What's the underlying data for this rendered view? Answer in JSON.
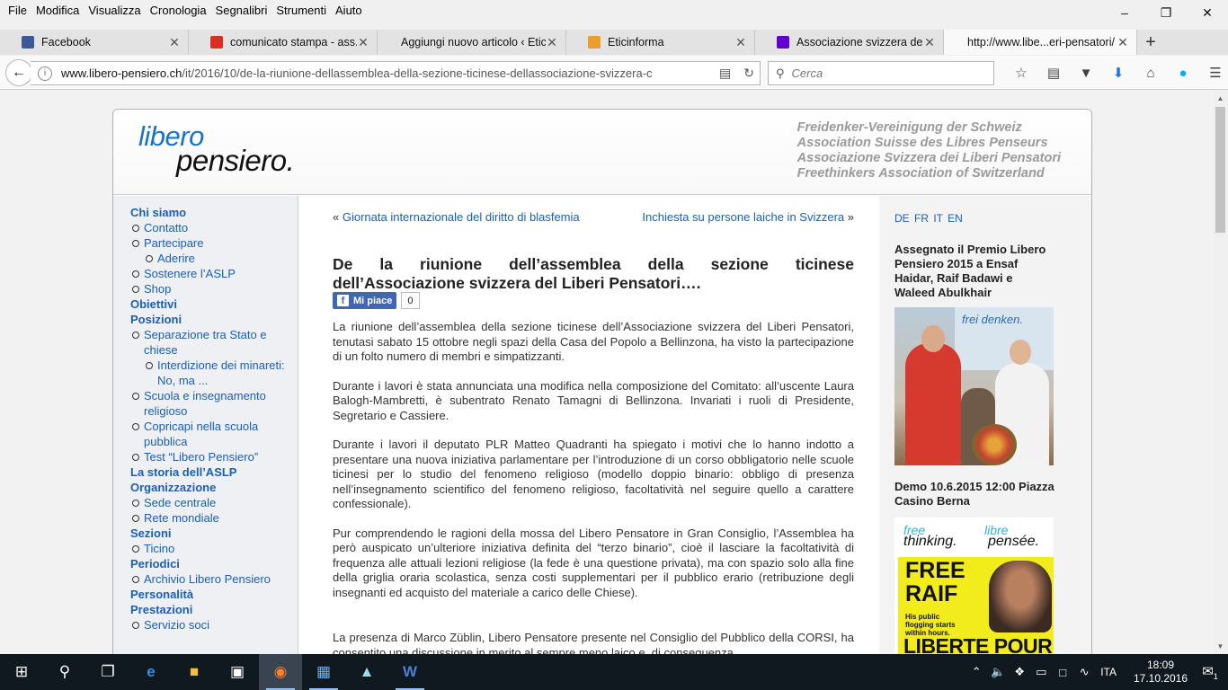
{
  "menubar": [
    "File",
    "Modifica",
    "Visualizza",
    "Cronologia",
    "Segnalibri",
    "Strumenti",
    "Aiuto"
  ],
  "tabs": [
    {
      "label": "Facebook",
      "color": "#3b5998"
    },
    {
      "label": "comunicato stampa - ass...",
      "color": "#d93025"
    },
    {
      "label": "Aggiungi nuovo articolo ‹ Etici...",
      "color": ""
    },
    {
      "label": "Eticinforma",
      "color": "#e8a02a"
    },
    {
      "label": "Associazione svizzera del L...",
      "color": "#5f01d1"
    },
    {
      "label": "http://www.libe...eri-pensatori/",
      "color": ""
    }
  ],
  "url": {
    "domain": "www.libero-pensiero.ch",
    "path": "/it/2016/10/de-la-riunione-dellassemblea-della-sezione-ticinese-dellassociazione-svizzera-c"
  },
  "search": {
    "placeholder": "Cerca"
  },
  "site": {
    "logo_top": "libero",
    "logo_bottom": "pensiero.",
    "taglines": [
      "Freidenker-Vereinigung der Schweiz",
      "Association Suisse des Libres Penseurs",
      "Associazione Svizzera dei Liberi Pensatori",
      "Freethinkers Association of Switzerland"
    ]
  },
  "leftnav": [
    {
      "type": "sec",
      "label": "Chi siamo"
    },
    {
      "type": "it",
      "label": "Contatto"
    },
    {
      "type": "it",
      "label": "Partecipare"
    },
    {
      "type": "it2",
      "label": "Aderire"
    },
    {
      "type": "it",
      "label": "Sostenere l’ASLP"
    },
    {
      "type": "it",
      "label": "Shop"
    },
    {
      "type": "sec",
      "label": "Obiettivi"
    },
    {
      "type": "sec",
      "label": "Posizioni"
    },
    {
      "type": "it",
      "label": "Separazione tra Stato e chiese"
    },
    {
      "type": "it2",
      "label": "Interdizione dei minareti: No, ma ..."
    },
    {
      "type": "it",
      "label": "Scuola e insegnamento religioso"
    },
    {
      "type": "it",
      "label": "Copricapi nella scuola pubblica"
    },
    {
      "type": "it",
      "label": "Test “Libero Pensiero”"
    },
    {
      "type": "sec",
      "label": "La storia dell’ASLP"
    },
    {
      "type": "sec",
      "label": "Organizzazione"
    },
    {
      "type": "it",
      "label": "Sede centrale"
    },
    {
      "type": "it",
      "label": "Rete mondiale"
    },
    {
      "type": "sec",
      "label": "Sezioni"
    },
    {
      "type": "it",
      "label": "Ticino"
    },
    {
      "type": "sec",
      "label": "Periodici"
    },
    {
      "type": "it",
      "label": "Archivio Libero Pensiero"
    },
    {
      "type": "sec",
      "label": "Personalità"
    },
    {
      "type": "sec",
      "label": "Prestazioni"
    },
    {
      "type": "it",
      "label": "Servizio soci"
    }
  ],
  "post_nav": {
    "prev": "Giornata internazionale del diritto di blasfemia",
    "next": "Inchiesta su persone laiche in Svizzera",
    "prev_arrow": "«",
    "next_arrow": "»"
  },
  "article": {
    "title": "De la riunione dell’assemblea della sezione ticinese dell’Associazione svizzera del Liberi Pensatori….",
    "like_label": "Mi piace",
    "like_count": "0",
    "paragraphs": [
      "La riunione dell’assemblea della sezione ticinese dell’Associazione svizzera del Liberi Pensatori, tenutasi sabato 15 ottobre negli spazi della Casa del Popolo a Bellinzona, ha visto la partecipazione di un folto numero di membri e simpatizzanti.",
      "Durante i lavori è stata annunciata una modifica nella composizione del Comitato: all’uscente Laura Balogh-Mambretti, è subentrato Renato Tamagni di Bellinzona. Invariati i ruoli di Presidente, Segretario e Cassiere.",
      "Durante i lavori il deputato PLR Matteo Quadranti ha spiegato i motivi che lo hanno indotto a presentare una nuova iniziativa parlamentare per l’introduzione di un corso obbligatorio nelle scuole ticinesi per lo studio del fenomeno religioso (modello doppio binario: obbligo di presenza nell’insegnamento scientifico del fenomeno religioso, facoltatività nel seguire quello a carattere confessionale).",
      "Pur comprendendo le ragioni della mossa del Libero Pensatore in Gran Consiglio, l’Assemblea ha però auspicato un’ulteriore iniziativa definita del “terzo binario”, cioè il lasciare la facoltatività di frequenza alle attuali lezioni religiose (la fede è una questione privata), ma con spazio solo alla fine della griglia oraria scolastica, senza costi supplementari per il pubblico erario (retribuzione degli insegnanti ed acquisto del materiale a carico delle Chiese).",
      "La presenza di Marco Züblin, Libero Pensatore presente nel Consiglio del Pubblico della CORSI, ha consentito una discussione in merito al sempre meno laico e, di conseguenza, …"
    ]
  },
  "right": {
    "langs": "DE FR IT EN",
    "news_title": "Assegnato il Premio Libero Pensiero 2015 a Ensaf Haidar, Raif Badawi e Waleed Abulkhair",
    "photo_banner": "frei denken.",
    "event_title": "Demo 10.6.2015 12:00 Piazza Casino Berna",
    "poster": {
      "free_a": "free",
      "free_b": "thinking.",
      "libre_a": "libre",
      "libre_b": "pensée.",
      "free_raif": "FREE RAIF",
      "sub": "His public flogging starts within hours.",
      "liberte": "LIBERTE POUR"
    }
  },
  "taskbar": {
    "lang": "ITA",
    "time": "18:09",
    "date": "17.10.2016",
    "notif_count": "1"
  }
}
